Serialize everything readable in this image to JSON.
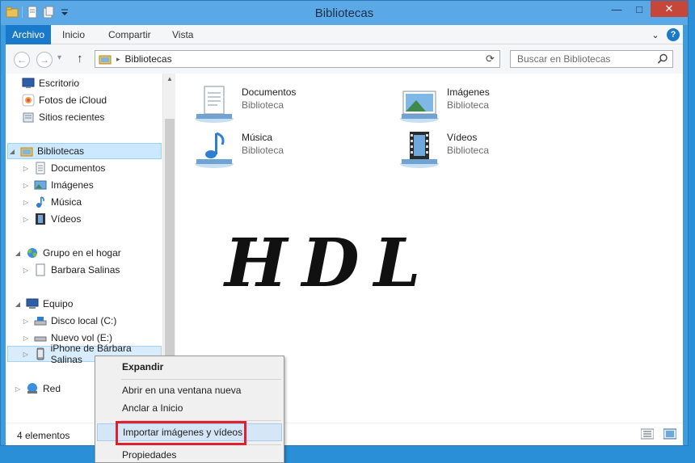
{
  "window": {
    "title": "Bibliotecas",
    "controls": {
      "minimize": "—",
      "maximize": "□",
      "close": "✕"
    }
  },
  "ribbon": {
    "tabs": [
      "Archivo",
      "Inicio",
      "Compartir",
      "Vista"
    ],
    "expand_symbol": "⌄",
    "help_symbol": "?"
  },
  "navigation": {
    "back_symbol": "←",
    "forward_symbol": "→",
    "up_symbol": "↑",
    "recent_symbol": "▾",
    "address_path": "Bibliotecas",
    "address_separator": "▸",
    "refresh_symbol": "⟳",
    "search_placeholder": "Buscar en Bibliotecas"
  },
  "nav_pane": {
    "favorites": [
      {
        "label": "Escritorio",
        "icon": "desktop-icon"
      },
      {
        "label": "Fotos de iCloud",
        "icon": "icloud-photos-icon"
      },
      {
        "label": "Sitios recientes",
        "icon": "recent-places-icon"
      }
    ],
    "libraries": {
      "label": "Bibliotecas",
      "children": [
        "Documentos",
        "Imágenes",
        "Música",
        "Vídeos"
      ]
    },
    "homegroup": {
      "label": "Grupo en el hogar",
      "children": [
        "Barbara Salinas"
      ]
    },
    "computer": {
      "label": "Equipo",
      "children": [
        "Disco local (C:)",
        "Nuevo vol (E:)",
        "iPhone de Bárbara Salinas"
      ]
    },
    "network": {
      "label": "Red"
    },
    "expanded_symbol": "◢",
    "collapsed_symbol": "▷"
  },
  "main": {
    "libraries": [
      {
        "name": "Documentos",
        "type": "Biblioteca",
        "icon": "documents-library-icon"
      },
      {
        "name": "Imágenes",
        "type": "Biblioteca",
        "icon": "pictures-library-icon"
      },
      {
        "name": "Música",
        "type": "Biblioteca",
        "icon": "music-library-icon"
      },
      {
        "name": "Vídeos",
        "type": "Biblioteca",
        "icon": "videos-library-icon"
      }
    ],
    "watermark": "HDL"
  },
  "status": {
    "count": "4 elementos"
  },
  "context_menu": {
    "items": [
      "Expandir",
      "Abrir en una ventana nueva",
      "Anclar a Inicio",
      "Importar imágenes y vídeos",
      "Propiedades"
    ],
    "highlighted_index": 3
  },
  "colors": {
    "accent": "#1979ca",
    "selection": "#cce8ff",
    "highlight_box": "#e11f2d"
  }
}
